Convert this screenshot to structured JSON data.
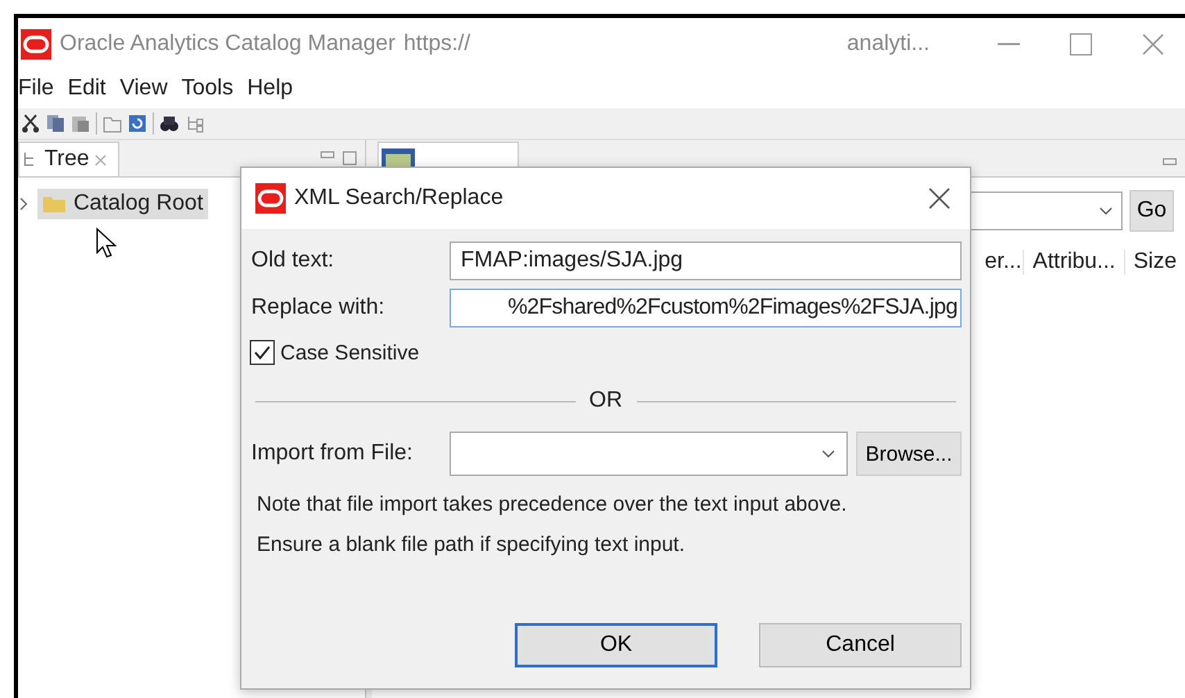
{
  "window": {
    "title": "Oracle Analytics Catalog Manager",
    "url": "https://",
    "host": "analyti..."
  },
  "menu": [
    "File",
    "Edit",
    "View",
    "Tools",
    "Help"
  ],
  "tree_panel": {
    "tab": "Tree",
    "items": [
      {
        "label": "Catalog Root",
        "selected": true,
        "expanded": false
      }
    ]
  },
  "table_panel": {
    "go_button": "Go",
    "columns": [
      "er...",
      "Attribu...",
      "Size"
    ]
  },
  "dialog": {
    "title": "XML Search/Replace",
    "old_text": {
      "label": "Old text:",
      "value": "FMAP:images/SJA.jpg"
    },
    "replace_with": {
      "label": "Replace with:",
      "value": "%2Fshared%2Fcustom%2Fimages%2FSJA.jpg"
    },
    "case_sensitive": {
      "label": "Case Sensitive",
      "checked": true
    },
    "separator": "OR",
    "import_file": {
      "label": "Import from File:",
      "button": "Browse..."
    },
    "notes": [
      "Note that file import takes precedence over the text input above.",
      "Ensure a blank file path if specifying text input."
    ],
    "buttons": [
      {
        "label": "OK",
        "default": true
      },
      {
        "label": "Cancel",
        "default": false
      }
    ]
  }
}
